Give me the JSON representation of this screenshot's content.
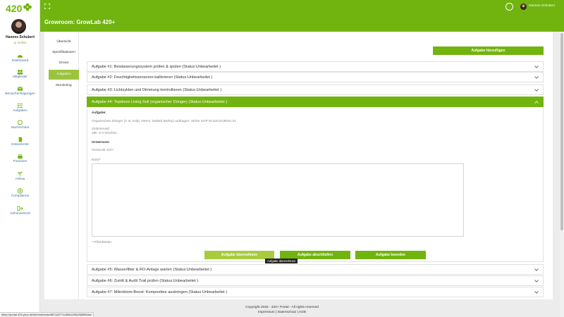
{
  "sidebar": {
    "logo_text": "420",
    "user": {
      "name": "Hannes Schubert",
      "status": "Online"
    },
    "items": [
      {
        "label": "Dashboard",
        "icon": "dashboard-icon"
      },
      {
        "label": "Mitglieder",
        "icon": "members-icon"
      },
      {
        "label": "Benachrichtigungen",
        "icon": "mail-icon"
      },
      {
        "label": "Aufgaben",
        "icon": "tasks-icon"
      },
      {
        "label": "Nachrichten",
        "icon": "chat-icon"
      },
      {
        "label": "Dokumente",
        "icon": "document-icon"
      },
      {
        "label": "Finanzen",
        "icon": "finance-icon"
      },
      {
        "label": "Anbau",
        "icon": "plant-icon"
      },
      {
        "label": "Compliance",
        "icon": "scale-icon"
      },
      {
        "label": "Adminansicht",
        "icon": "admin-icon"
      }
    ]
  },
  "header": {
    "title": "Growroom: GrowLab 420+",
    "user_name": "Hannes Schubert"
  },
  "tabs": [
    "Übersicht",
    "Spezifikationen",
    "Grows",
    "Aufgaben",
    "Monitoring"
  ],
  "active_tab": "Aufgaben",
  "add_task_label": "Aufgabe hinzufügen",
  "tasks_before": [
    "Aufgabe #1: Bewässerungssystem prüfen & spülen (Status:Unbearbeitet )",
    "Aufgabe #2: Feuchtigkeitssensoren kalibrieren (Status:Unbearbeitet )",
    "Aufgabe #3: Lichtzyklen und Dimmung kontrollieren (Status:Unbearbeitet )"
  ],
  "open_task": {
    "title": "Aufgabe #4: Topdress Living Soil (organischer Dünger) (Status:Unbearbeitet )",
    "aufgabe_label": "Aufgabe:",
    "aufgabe_text": "Organischen Dünger (z. B. Kelp, Neem, Malted Barley) auftragen. Siehe SOP W.420.DUENG.01",
    "zeitintervall_label": "Zeitintervall:",
    "zeitintervall_value": "alle: 3-4 Wochen",
    "growroom_label": "Growroom:",
    "growroom_value": "GrowLab 420+",
    "notiz_label": "Notiz*",
    "pflicht_note": "* Pflichtfelder",
    "btn_take": "Aufgabe übernehmen",
    "btn_complete": "Aufgabe abschließen",
    "btn_end": "Aufgabe beenden",
    "tooltip": "Aufgabe übernehmen"
  },
  "tasks_after": [
    "Aufgabe #5: Wasserfilter & RO-Anlage warten (Status:Unbearbeitet )",
    "Aufgabe #6: Zutritt & Audit Trail prüfen (Status:Unbearbeitet )",
    "Aufgabe #7: Mikrobiom-Boost: Komposttee ausbringen (Status:Unbearbeitet )"
  ],
  "footer": {
    "copyright": "Copyright 2025 - 420+ Portal - All rights reserved",
    "impressum": "Impressum",
    "datenschutz": "Datenschutz",
    "agb": "AGB"
  },
  "status_url": "https://portal.420-plus.de/internal/tasks/687a2377c48db4436c868f8/take",
  "colors": {
    "brand_green": "#71b40f",
    "tab_active": "#9bc43c",
    "link_blue": "#3a6fa8"
  }
}
